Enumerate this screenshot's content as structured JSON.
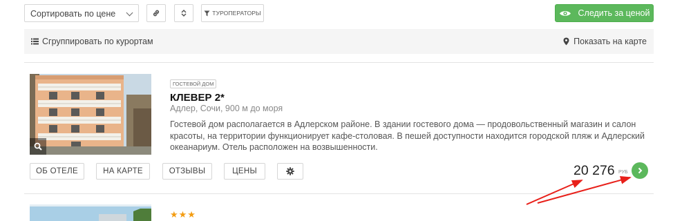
{
  "toolbar": {
    "sort_value": "Сортировать по цене",
    "touroperators_label": "Туроператоры",
    "follow_price_label": "Следить за ценой",
    "follow_color": "#5cb85c"
  },
  "group_bar": {
    "group_label": "Сгруппировать по курортам",
    "show_map_label": "Показать на карте"
  },
  "hotels": [
    {
      "type_badge": "Гостевой дом",
      "name": "КЛЕВЕР 2*",
      "location": "Адлер, Сочи, 900 м до моря",
      "description": "Гостевой дом располагается в Адлерском районе. В здании гостевого дома — продовольственный магазин и салон красоты, на территории функционирует кафе-столовая. В пешей доступности находится городской пляж и Адлерский океанариум. Отель расположен на возвышенности.",
      "actions": [
        "Об отеле",
        "На карте",
        "Отзывы",
        "Цены"
      ],
      "price": "20 276",
      "currency": "руб"
    },
    {
      "stars": "★★★",
      "star_color": "#f39c12"
    }
  ],
  "annotation_color": "#e8201a"
}
